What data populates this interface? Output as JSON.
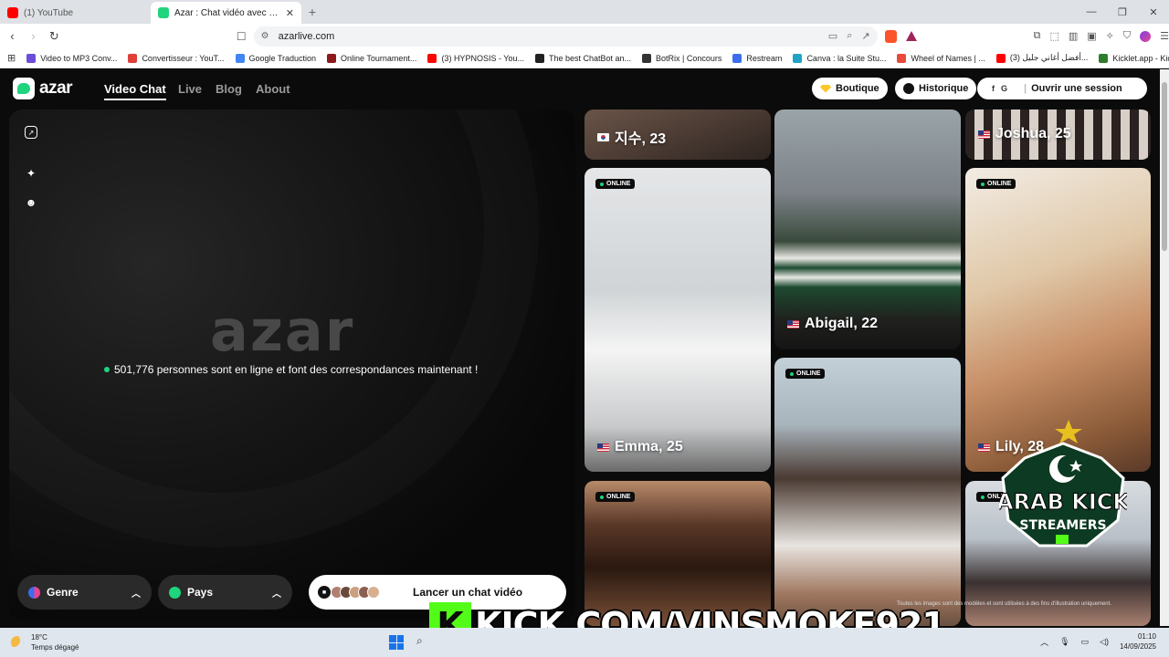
{
  "browser": {
    "tabs": [
      {
        "title": "(1) YouTube",
        "active": false,
        "favicon_color": "#ff0000"
      },
      {
        "title": "Azar : Chat vidéo avec de nouve",
        "active": true,
        "favicon_color": "#1fd47c"
      }
    ],
    "new_tab": "+",
    "url": "azarlive.com"
  },
  "bookmarks": [
    {
      "label": "Video to MP3 Conv...",
      "color": "#6c4cd8"
    },
    {
      "label": "Convertisseur : YouT...",
      "color": "#e0403a"
    },
    {
      "label": "Google Traduction",
      "color": "#4285f4"
    },
    {
      "label": "Online Tournament...",
      "color": "#8b1a1a"
    },
    {
      "label": "(3) HYPNOSIS - You...",
      "color": "#ff0000"
    },
    {
      "label": "The best ChatBot an...",
      "color": "#222222"
    },
    {
      "label": "BotRix | Concours",
      "color": "#333333"
    },
    {
      "label": "Restream",
      "color": "#3c6df0"
    },
    {
      "label": "Canva : la Suite Stu...",
      "color": "#1fa3c4"
    },
    {
      "label": "Wheel of Names | ...",
      "color": "#e84a3c"
    },
    {
      "label": "(3) أفضل أغاني جليل...",
      "color": "#ff0000"
    },
    {
      "label": "Kicklet.app - Kick C...",
      "color": "#2d7d2d"
    }
  ],
  "site": {
    "logo_text": "azar",
    "nav": [
      {
        "label": "Video Chat",
        "active": true
      },
      {
        "label": "Live",
        "active": false
      },
      {
        "label": "Blog",
        "active": false
      },
      {
        "label": "About",
        "active": false
      }
    ],
    "shop_label": "Boutique",
    "history_label": "Historique",
    "login_icons": [
      "",
      "f",
      "G",
      ""
    ],
    "login_label": "Ouvrir une session",
    "accent_color": "#1fd47c"
  },
  "stage": {
    "watermark": "azar",
    "online_message": "501,776 personnes sont en ligne et font des correspondances maintenant !",
    "gender_filter": "Genre",
    "country_filter": "Pays",
    "start_label": "Lancer un chat vidéo"
  },
  "profiles": [
    {
      "name": "지수, 23",
      "flag": "kr",
      "online": false
    },
    {
      "name": "Joshua, 25",
      "flag": "us",
      "online": false
    },
    {
      "name": "Emma, 25",
      "flag": "us",
      "online": true
    },
    {
      "name": "Abigail, 22",
      "flag": "us",
      "online": false
    },
    {
      "name": "Lily, 28",
      "flag": "us",
      "online": true
    },
    {
      "name": "",
      "flag": "",
      "online": true
    },
    {
      "name": "",
      "flag": "",
      "online": true
    },
    {
      "name": "",
      "flag": "",
      "online": true
    }
  ],
  "badge_label": "ONLINE",
  "disclaimer": "Toutes les images sont des modèles et sont utilisées à des fins d'illustration uniquement.",
  "overlay": {
    "emblem_top": "ARAB KICK",
    "emblem_bottom": "STREAMERS",
    "banner_letter": "K",
    "banner_url": "KICK.COM/VINSMOKE921"
  },
  "taskbar": {
    "temperature": "18°C",
    "weather": "Temps dégagé",
    "time": "01:10",
    "date": "14/09/2025"
  }
}
